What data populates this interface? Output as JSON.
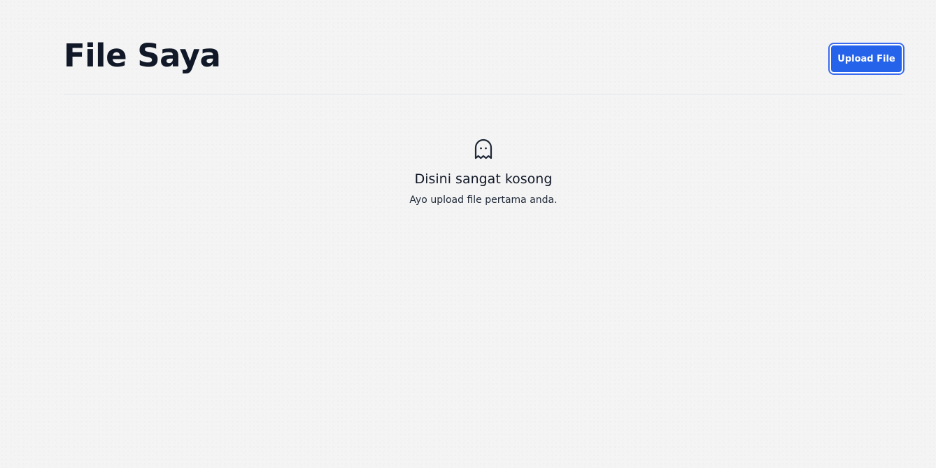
{
  "header": {
    "title": "File Saya",
    "upload_label": "Upload File"
  },
  "empty_state": {
    "icon": "ghost-icon",
    "title": "Disini sangat kosong",
    "subtitle": "Ayo upload file pertama anda."
  },
  "colors": {
    "accent": "#2563eb",
    "title_text": "#111827",
    "background": "#f4f4f4"
  }
}
